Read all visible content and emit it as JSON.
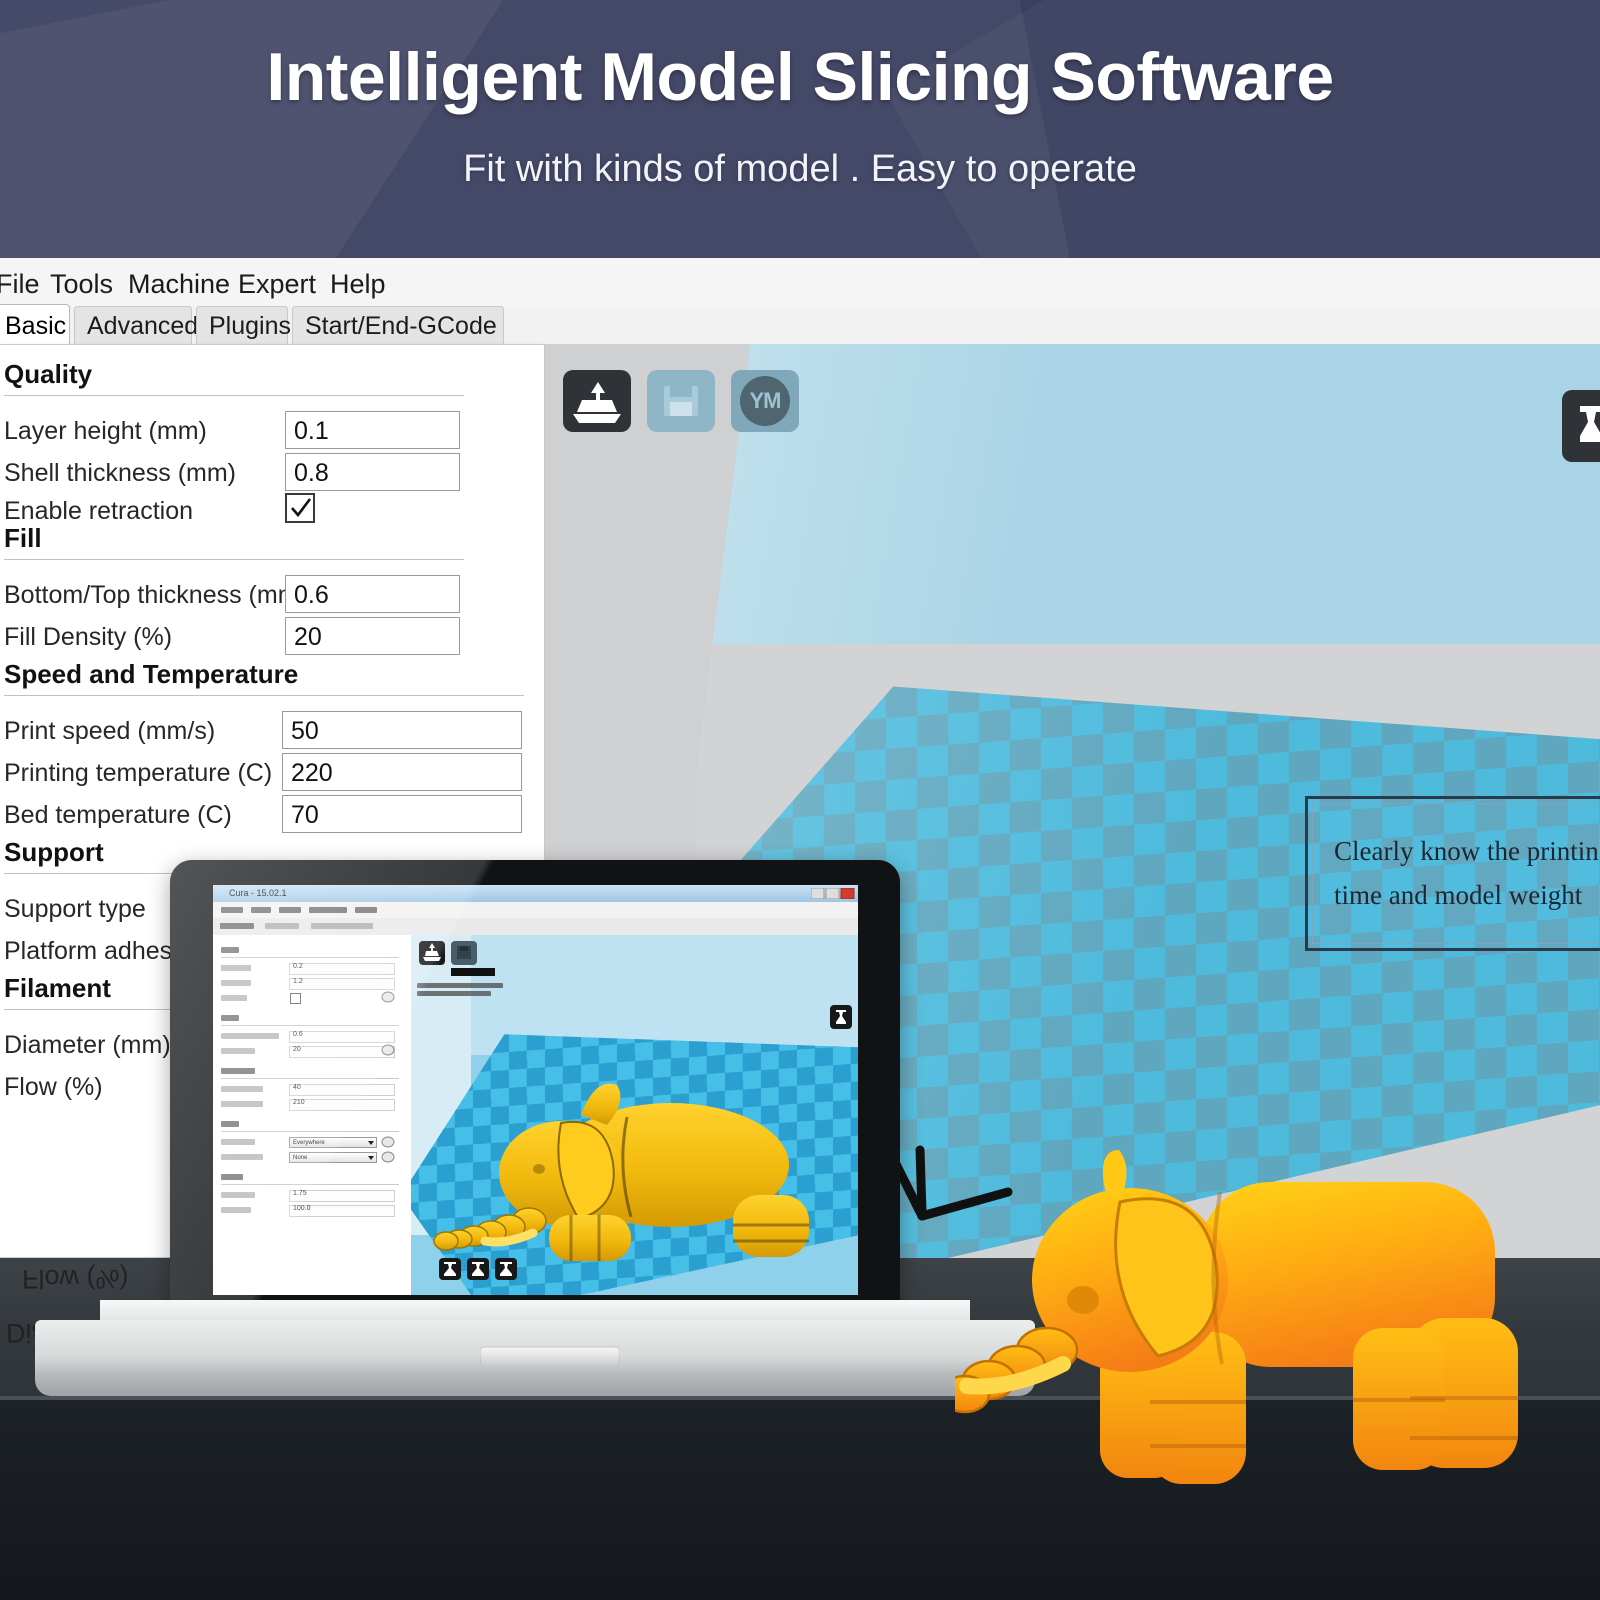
{
  "banner": {
    "title": "Intelligent Model Slicing Software",
    "subtitle": "Fit with kinds of model . Easy to operate",
    "bg_color": "#3b4060"
  },
  "app": {
    "menu": [
      "File",
      "Tools",
      "Machine",
      "Expert",
      "Help"
    ],
    "tabs": [
      {
        "label": "Basic",
        "active": true
      },
      {
        "label": "Advanced",
        "active": false
      },
      {
        "label": "Plugins",
        "active": false
      },
      {
        "label": "Start/End-GCode",
        "active": false
      }
    ],
    "groups": [
      {
        "title": "Quality",
        "rows": [
          {
            "label": "Layer height (mm)",
            "type": "text",
            "value": "0.1"
          },
          {
            "label": "Shell thickness (mm)",
            "type": "text",
            "value": "0.8"
          },
          {
            "label": "Enable retraction",
            "type": "checkbox",
            "value": "checked"
          }
        ]
      },
      {
        "title": "Fill",
        "rows": [
          {
            "label": "Bottom/Top thickness (mm)",
            "type": "text",
            "value": "0.6"
          },
          {
            "label": "Fill Density (%)",
            "type": "text",
            "value": "20"
          }
        ]
      },
      {
        "title": "Speed and Temperature",
        "rows": [
          {
            "label": "Print speed (mm/s)",
            "type": "text",
            "value": "50"
          },
          {
            "label": "Printing temperature (C)",
            "type": "text",
            "value": "220"
          },
          {
            "label": "Bed temperature (C)",
            "type": "text",
            "value": "70"
          }
        ]
      },
      {
        "title": "Support",
        "rows": [
          {
            "label": "Support type",
            "type": "text",
            "value": ""
          },
          {
            "label": "Platform adhesion",
            "type": "text",
            "value": ""
          }
        ]
      },
      {
        "title": "Filament",
        "rows": [
          {
            "label": "Diameter (mm)",
            "type": "text",
            "value": ""
          },
          {
            "label": "Flow (%)",
            "type": "text",
            "value": ""
          }
        ]
      }
    ]
  },
  "viewport": {
    "toolbar": [
      {
        "icon": "load-model-icon",
        "label": "",
        "state": "enabled"
      },
      {
        "icon": "save-toolpath-icon",
        "label": "",
        "state": "disabled"
      },
      {
        "icon": "youmagine-icon",
        "label": "YM",
        "state": "enabled"
      }
    ],
    "callout": {
      "line1": "Clearly know the printing",
      "line2": "time and model weight"
    },
    "bed_colors": {
      "light": "#4ebbdd",
      "dark": "#5fa7bf"
    },
    "background": "#a9d4e6"
  },
  "laptop": {
    "window_title": "Cura - 15.02.1",
    "inner": {
      "selects": [
        {
          "value": "Everywhere"
        },
        {
          "value": "None"
        }
      ],
      "values": [
        "0.2",
        "1.2",
        "0.6",
        "20",
        "40",
        "210",
        "1.75",
        "100.0"
      ]
    }
  },
  "reflection": {
    "line1": "Flow (%)",
    "line2": "Diameter (mm)"
  }
}
